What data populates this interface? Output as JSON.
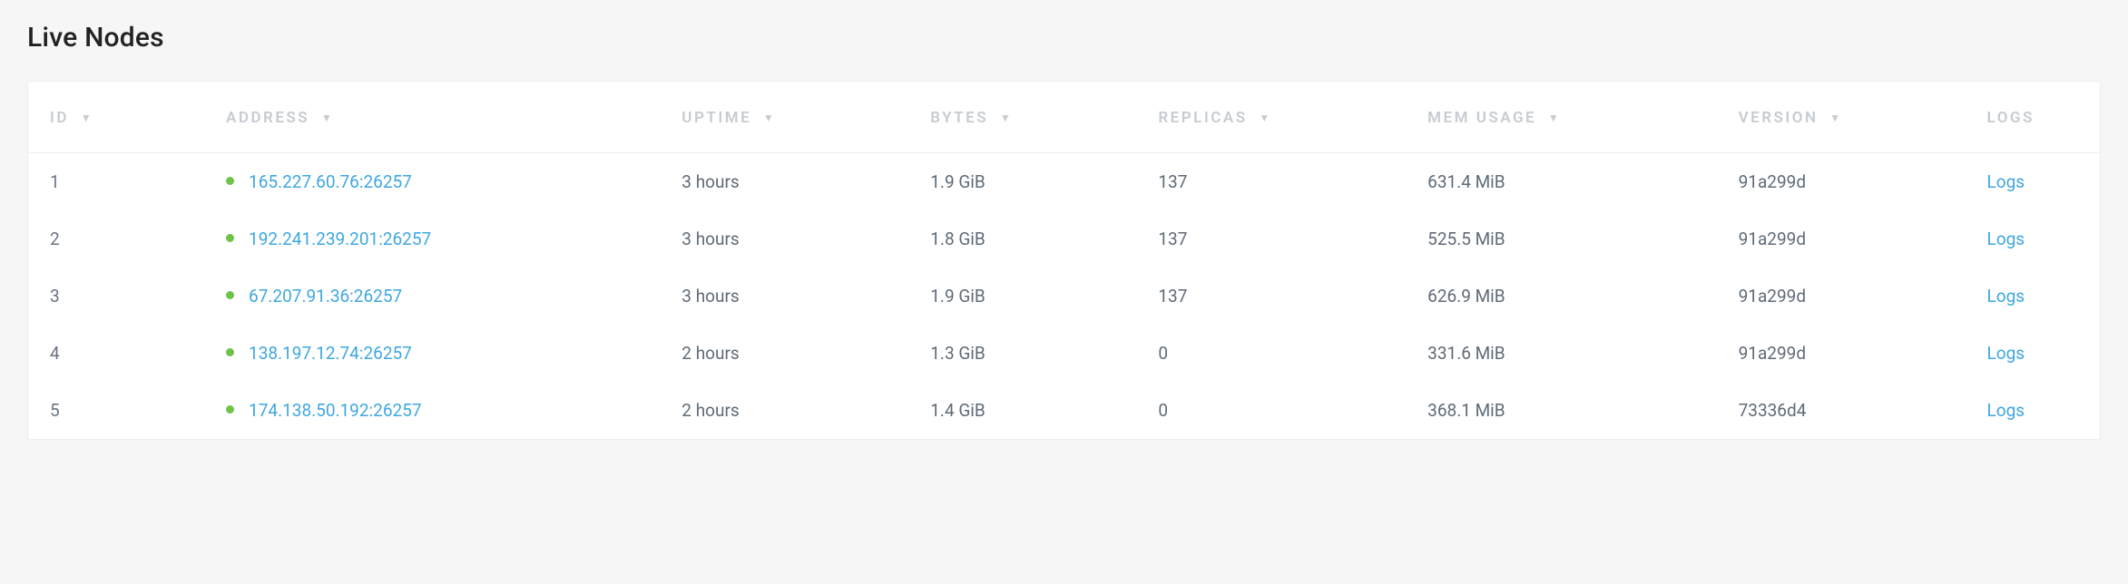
{
  "title": "Live Nodes",
  "columns": {
    "id": {
      "label": "ID",
      "sortable": true
    },
    "address": {
      "label": "ADDRESS",
      "sortable": true
    },
    "uptime": {
      "label": "UPTIME",
      "sortable": true
    },
    "bytes": {
      "label": "BYTES",
      "sortable": true
    },
    "replicas": {
      "label": "REPLICAS",
      "sortable": true
    },
    "mem": {
      "label": "MEM USAGE",
      "sortable": true
    },
    "version": {
      "label": "VERSION",
      "sortable": true
    },
    "logs": {
      "label": "LOGS",
      "sortable": false
    }
  },
  "logs_link_label": "Logs",
  "status_color": "#6fc24a",
  "link_color": "#3fa7e0",
  "rows": [
    {
      "id": "1",
      "address": "165.227.60.76:26257",
      "uptime": "3 hours",
      "bytes": "1.9 GiB",
      "replicas": "137",
      "mem": "631.4 MiB",
      "version": "91a299d"
    },
    {
      "id": "2",
      "address": "192.241.239.201:26257",
      "uptime": "3 hours",
      "bytes": "1.8 GiB",
      "replicas": "137",
      "mem": "525.5 MiB",
      "version": "91a299d"
    },
    {
      "id": "3",
      "address": "67.207.91.36:26257",
      "uptime": "3 hours",
      "bytes": "1.9 GiB",
      "replicas": "137",
      "mem": "626.9 MiB",
      "version": "91a299d"
    },
    {
      "id": "4",
      "address": "138.197.12.74:26257",
      "uptime": "2 hours",
      "bytes": "1.3 GiB",
      "replicas": "0",
      "mem": "331.6 MiB",
      "version": "91a299d"
    },
    {
      "id": "5",
      "address": "174.138.50.192:26257",
      "uptime": "2 hours",
      "bytes": "1.4 GiB",
      "replicas": "0",
      "mem": "368.1 MiB",
      "version": "73336d4"
    }
  ]
}
